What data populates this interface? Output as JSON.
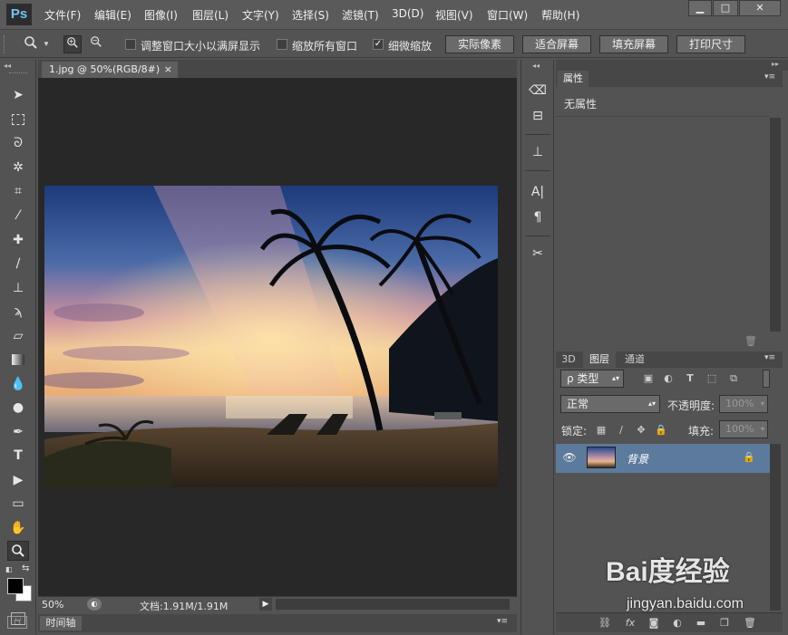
{
  "app": {
    "logo": "Ps"
  },
  "menu": [
    "文件(F)",
    "编辑(E)",
    "图像(I)",
    "图层(L)",
    "文字(Y)",
    "选择(S)",
    "滤镜(T)",
    "3D(D)",
    "视图(V)",
    "窗口(W)",
    "帮助(H)"
  ],
  "window_controls": {
    "minimize": "▁",
    "maximize": "□",
    "close": "✕"
  },
  "options": {
    "tool_icon": "zoom-tool-icon",
    "check1_label": "调整窗口大小以满屏显示",
    "check1_checked": "",
    "check2_label": "缩放所有窗口",
    "check2_checked": "",
    "check3_label": "细微缩放",
    "check3_checked": "✓",
    "btn_actual": "实际像素",
    "btn_fit": "适合屏幕",
    "btn_fill": "填充屏幕",
    "btn_print": "打印尺寸"
  },
  "document": {
    "tab_title": "1.jpg @ 50%(RGB/8#)",
    "tab_close": "×",
    "zoom": "50%",
    "doc_info": "文档:1.91M/1.91M"
  },
  "timeline": {
    "label": "时间轴"
  },
  "properties": {
    "tab": "属性",
    "content": "无属性"
  },
  "layers": {
    "tabs": [
      "3D",
      "图层",
      "通道"
    ],
    "filter_label": "ρ 类型",
    "blend_mode": "正常",
    "opacity_label": "不透明度:",
    "opacity_value": "100%",
    "lock_label": "锁定:",
    "fill_label": "填充:",
    "fill_value": "100%",
    "layer_name": "背景"
  },
  "watermark": {
    "brand": "Bai度经验",
    "url": "jingyan.baidu.com"
  },
  "colors": {
    "ui_bg": "#535353",
    "canvas_bg": "#282828",
    "selected_layer": "#5c7a9c",
    "ps_logo": "#6ec5ff"
  }
}
